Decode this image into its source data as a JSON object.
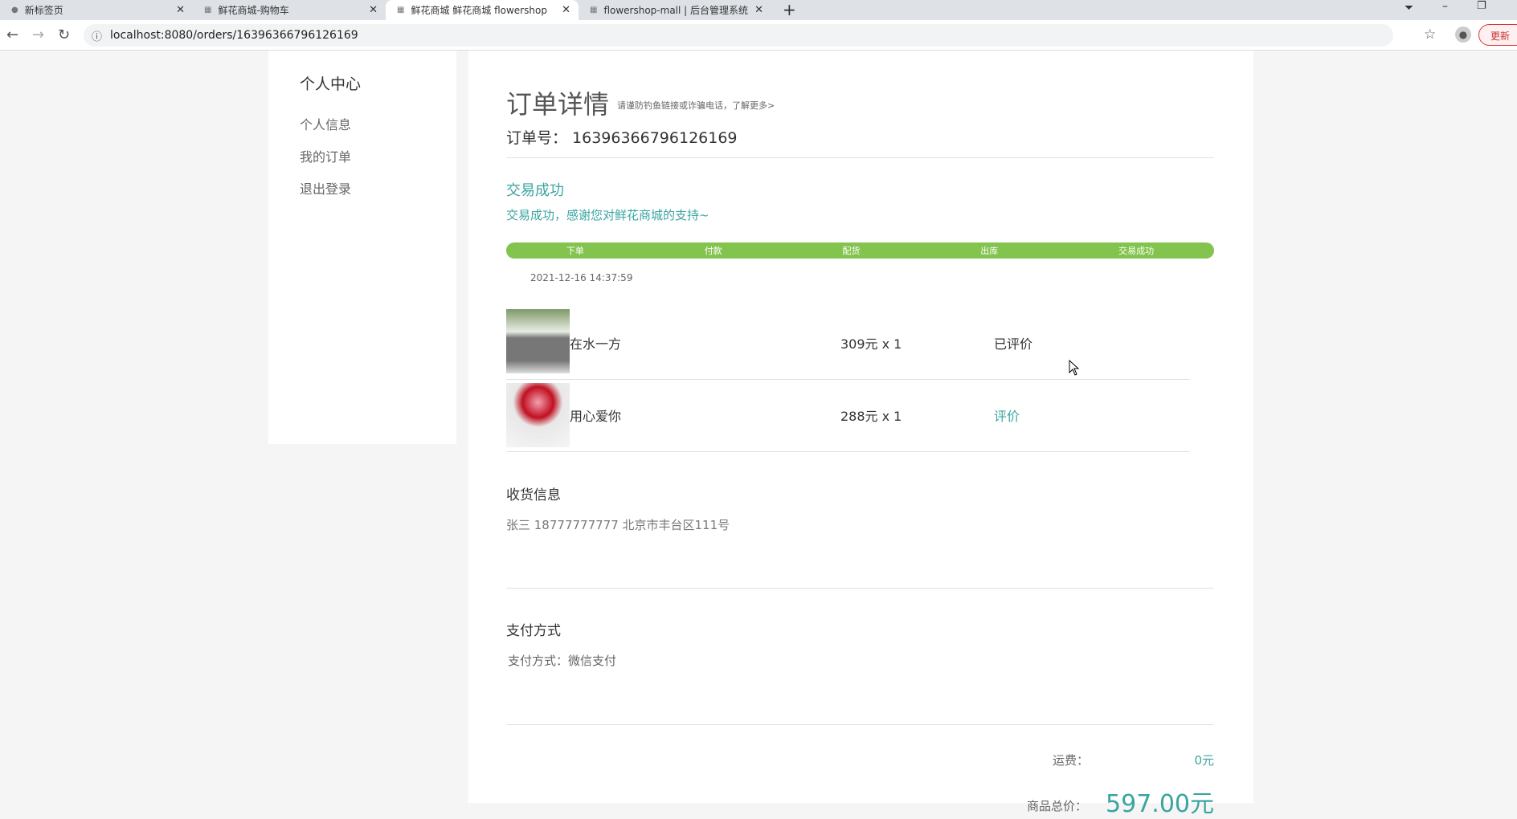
{
  "browser": {
    "tabs": [
      {
        "title": "新标签页",
        "icon": "globe-icon"
      },
      {
        "title": "鲜花商城-购物车",
        "icon": "newbee-icon"
      },
      {
        "title": "鲜花商城 鲜花商城 flowershop",
        "icon": "newbee-icon"
      },
      {
        "title": "flowershop-mall | 后台管理系统",
        "icon": "newbee-icon"
      }
    ],
    "url": "localhost:8080/orders/16396366796126169",
    "update_label": "更新"
  },
  "sidebar": {
    "title": "个人中心",
    "items": [
      {
        "label": "个人信息"
      },
      {
        "label": "我的订单"
      },
      {
        "label": "退出登录"
      }
    ]
  },
  "order": {
    "title": "订单详情",
    "warning": "请谨防钓鱼链接或诈骗电话，了解更多>",
    "number_label": "订单号：",
    "number": "16396366796126169",
    "status": "交易成功",
    "status_message": "交易成功，感谢您对鲜花商城的支持~",
    "steps": [
      "下单",
      "付款",
      "配货",
      "出库",
      "交易成功"
    ],
    "progress_percent": 100,
    "time": "2021-12-16 14:37:59",
    "items": [
      {
        "name": "在水一方",
        "price": "309元 x 1",
        "action": "已评价"
      },
      {
        "name": "用心爱你",
        "price": "288元 x 1",
        "action": "评价"
      }
    ],
    "shipping_title": "收货信息",
    "shipping_info": "张三 18777777777 北京市丰台区111号",
    "payment_title": "支付方式",
    "payment_info": "支付方式：微信支付",
    "freight_label": "运费：",
    "freight_value": "0元",
    "total_label": "商品总价：",
    "total_value": "597.00元"
  },
  "colors": {
    "accent": "#3aa5a0",
    "progress": "#83c44e"
  }
}
